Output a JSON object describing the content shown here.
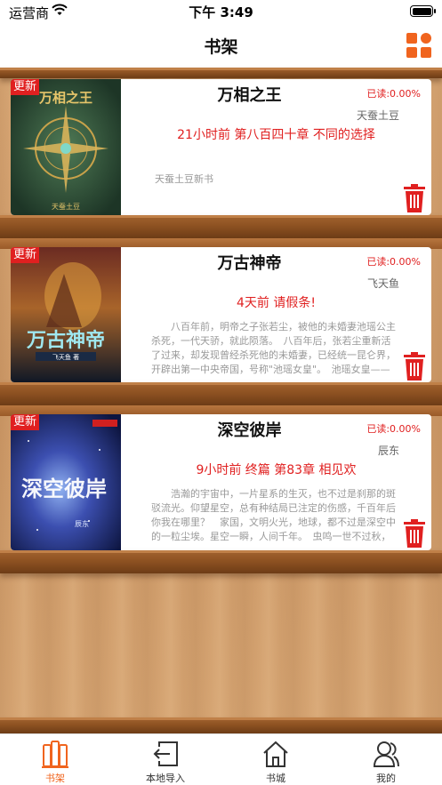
{
  "status_bar": {
    "carrier": "运营商",
    "time": "下午 3:49"
  },
  "nav": {
    "title": "书架",
    "grid_icon": "grid-icon"
  },
  "books": [
    {
      "badge": "更新",
      "title": "万相之王",
      "progress": "已读:0.00%",
      "author": "天蚕土豆",
      "latest": "21小时前  第八百四十章 不同的选择",
      "description": "天蚕土豆新书",
      "cover_title": "万相之王",
      "cover_author": "天蚕土豆",
      "cover_color": "#2e4a34"
    },
    {
      "badge": "更新",
      "title": "万古神帝",
      "progress": "已读:0.00%",
      "author": "飞天鱼",
      "latest": "4天前  请假条!",
      "description": "八百年前，明帝之子张若尘，被他的未婚妻池瑶公主杀死，一代天骄，就此陨落。　八百年后，张若尘重新活了过来，却发现曾经杀死他的未婚妻，已经统一昆仑界，开辟出第一中央帝国，号称\"池瑶女皇\"。　池瑶女皇——统御天下，威临八方；青春永驻，不死不灭。",
      "cover_title": "万古神帝",
      "cover_sub": "飞天鱼 著",
      "cover_color": "#27324a"
    },
    {
      "badge": "更新",
      "title": "深空彼岸",
      "progress": "已读:0.00%",
      "author": "辰东",
      "latest": "9小时前  终篇 第83章 相见欢",
      "description": "浩瀚的宇宙中，一片星系的生灭，也不过是刹那的斑驳流光。仰望星空，总有种结局已注定的伤感，千百年后你我在哪里？　家国，文明火光，地球，都不过是深空中的一粒尘埃。星空一瞬，人间千年。　虫鸣一世不过秋，你我一样在争渡。深空尽头到底有什么？",
      "cover_title": "深空彼岸",
      "cover_author": "辰东",
      "cover_color": "#2a3f8a"
    }
  ],
  "tabs": [
    {
      "label": "书架",
      "icon": "bookshelf-icon",
      "active": true
    },
    {
      "label": "本地导入",
      "icon": "import-icon",
      "active": false
    },
    {
      "label": "书城",
      "icon": "home-icon",
      "active": false
    },
    {
      "label": "我的",
      "icon": "user-icon",
      "active": false
    }
  ],
  "colors": {
    "accent": "#f0641e",
    "red": "#e02020"
  }
}
